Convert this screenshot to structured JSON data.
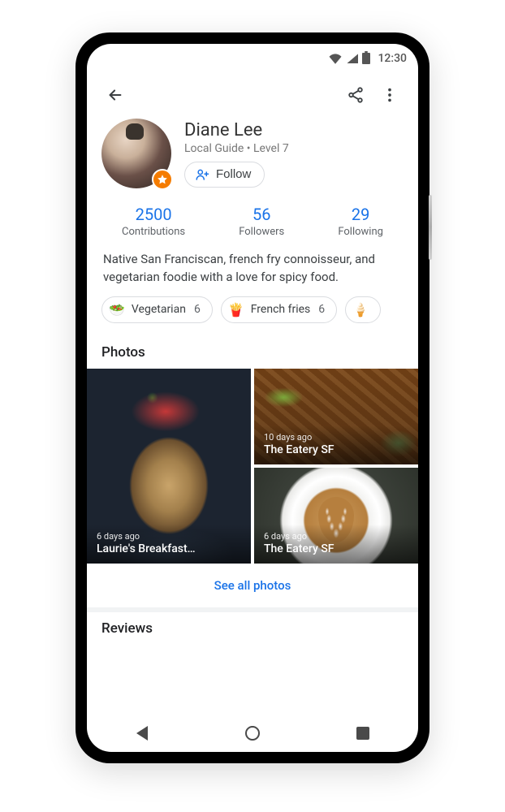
{
  "statusbar": {
    "time": "12:30"
  },
  "profile": {
    "name": "Diane Lee",
    "subtitle": "Local Guide • Level 7",
    "follow_label": "Follow",
    "badge": "star-badge"
  },
  "stats": [
    {
      "value": "2500",
      "label": "Contributions"
    },
    {
      "value": "56",
      "label": "Followers"
    },
    {
      "value": "29",
      "label": "Following"
    }
  ],
  "bio": "Native San Franciscan, french fry connoisseur, and vegetarian foodie with a love for spicy food.",
  "chips": [
    {
      "emoji": "🥗",
      "label": "Vegetarian",
      "count": "6"
    },
    {
      "emoji": "🍟",
      "label": "French fries",
      "count": "6"
    },
    {
      "emoji": "🍦",
      "label": "",
      "count": ""
    }
  ],
  "photos_section": {
    "title": "Photos",
    "see_all": "See all photos"
  },
  "photos": [
    {
      "ago": "6 days ago",
      "title": "Laurie's Breakfast…"
    },
    {
      "ago": "10 days ago",
      "title": "The Eatery SF"
    },
    {
      "ago": "6 days ago",
      "title": "The Eatery SF"
    }
  ],
  "reviews_section": {
    "title": "Reviews"
  }
}
